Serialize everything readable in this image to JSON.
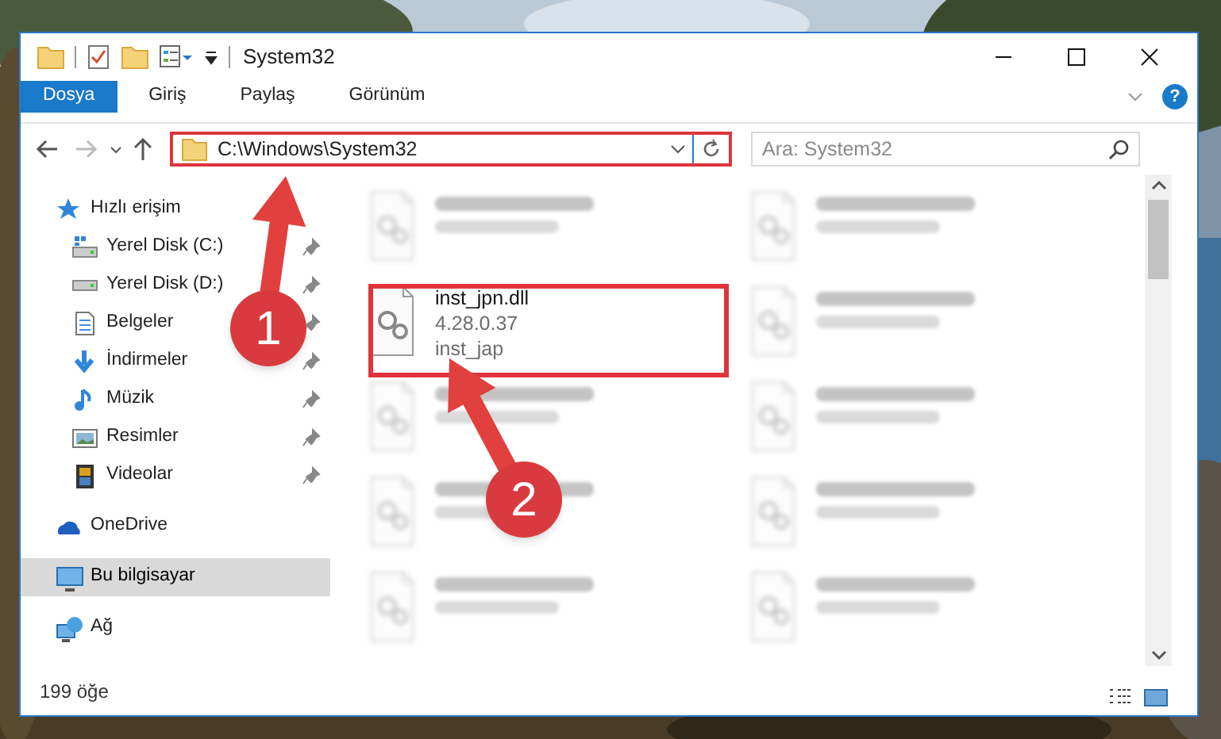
{
  "window": {
    "title": "System32"
  },
  "ribbon_tabs": [
    {
      "label": "Dosya",
      "selected": true
    },
    {
      "label": "Giriş",
      "selected": false
    },
    {
      "label": "Paylaş",
      "selected": false
    },
    {
      "label": "Görünüm",
      "selected": false
    }
  ],
  "help_label": "?",
  "address": {
    "path": "C:\\Windows\\System32"
  },
  "search": {
    "placeholder": "Ara: System32"
  },
  "nav": [
    {
      "label": "Hızlı erişim",
      "kind": "star",
      "selected": false,
      "children": [
        {
          "label": "Yerel Disk (C:)",
          "kind": "drive-c",
          "selected": false,
          "pinned": true
        },
        {
          "label": "Yerel Disk (D:)",
          "kind": "drive",
          "selected": false,
          "pinned": true
        },
        {
          "label": "Belgeler",
          "kind": "document",
          "selected": false,
          "pinned": true
        },
        {
          "label": "İndirmeler",
          "kind": "download",
          "selected": false,
          "pinned": true
        },
        {
          "label": "Müzik",
          "kind": "music",
          "selected": false,
          "pinned": true
        },
        {
          "label": "Resimler",
          "kind": "pictures",
          "selected": false,
          "pinned": true
        },
        {
          "label": "Videolar",
          "kind": "videos",
          "selected": false,
          "pinned": true
        }
      ]
    },
    {
      "label": "OneDrive",
      "kind": "cloud",
      "selected": false
    },
    {
      "label": "Bu bilgisayar",
      "kind": "computer",
      "selected": true
    },
    {
      "label": "Ağ",
      "kind": "network",
      "selected": false
    }
  ],
  "files": [
    {
      "kind": "blurred"
    },
    {
      "kind": "blurred"
    },
    {
      "kind": "file",
      "name": "inst_jpn.dll",
      "details": [
        "4.28.0.37",
        "inst_jap"
      ]
    },
    {
      "kind": "blurred"
    },
    {
      "kind": "blurred"
    },
    {
      "kind": "blurred"
    },
    {
      "kind": "blurred"
    },
    {
      "kind": "blurred"
    },
    {
      "kind": "blurred"
    },
    {
      "kind": "blurred"
    }
  ],
  "status_bar": {
    "item_count": "199 öğe"
  },
  "callouts": [
    {
      "number": "1"
    },
    {
      "number": "2"
    }
  ]
}
